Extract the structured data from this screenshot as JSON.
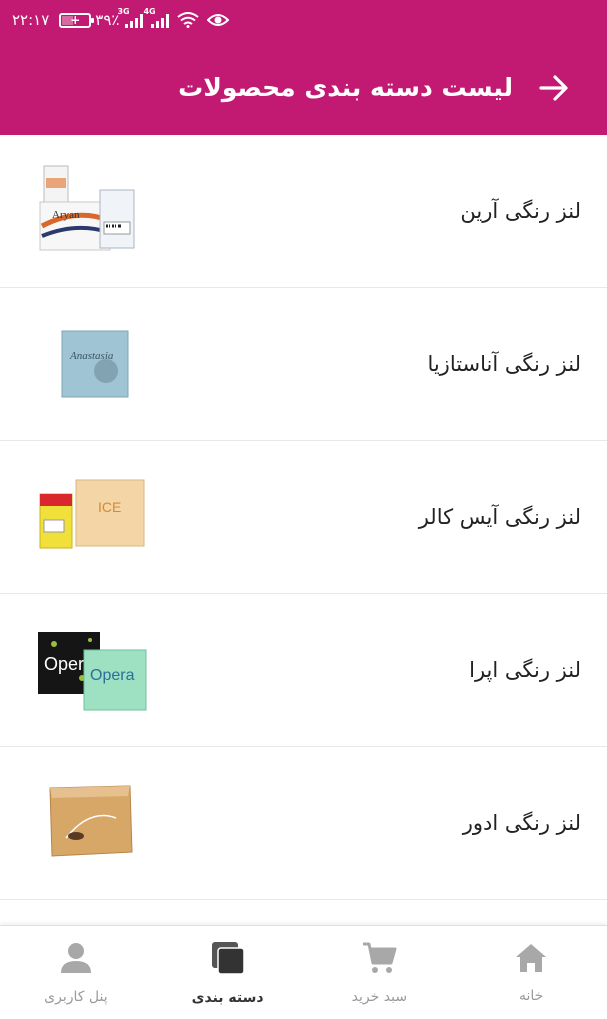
{
  "status_bar": {
    "time": "۲۲:۱۷",
    "battery_percent": "۳۹٪",
    "network_3g": "3G",
    "network_4g": "4G"
  },
  "header": {
    "title": "لیست دسته بندی محصولات",
    "back_icon": "arrow-right-icon"
  },
  "categories": [
    {
      "label": "لنز رنگی آرین"
    },
    {
      "label": "لنز رنگی آناستازیا"
    },
    {
      "label": "لنز رنگی آیس کالر"
    },
    {
      "label": "لنز رنگی اپرا"
    },
    {
      "label": "لنز رنگی ادور"
    }
  ],
  "bottom_nav": {
    "home": "خانه",
    "cart": "سبد خرید",
    "categories": "دسته بندی",
    "user_panel": "پنل کاربری",
    "active": "categories"
  },
  "colors": {
    "primary": "#c21a72",
    "nav_inactive": "#9a9a9a",
    "nav_active": "#333333"
  }
}
